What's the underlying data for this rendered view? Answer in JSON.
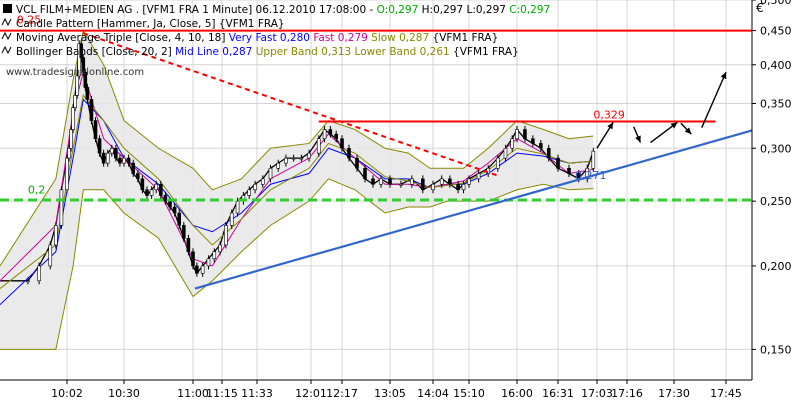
{
  "chart_data": {
    "type": "line",
    "subtype": "candlestick",
    "currency": "€",
    "watermark": "www.tradesignalonline.com",
    "legend_placement": "top-left",
    "log_scale": true,
    "grid": true,
    "ylim": [
      0.135,
      0.5
    ],
    "xlim": [
      "09:50",
      "17:50"
    ],
    "y_ticks": [
      {
        "value": 0.5,
        "label": "0,500"
      },
      {
        "value": 0.45,
        "label": "0,450"
      },
      {
        "value": 0.4,
        "label": "0,400"
      },
      {
        "value": 0.35,
        "label": "0,350"
      },
      {
        "value": 0.3,
        "label": "0,300"
      },
      {
        "value": 0.25,
        "label": "0,250"
      },
      {
        "value": 0.2,
        "label": "0,200"
      },
      {
        "value": 0.15,
        "label": "0,150"
      }
    ],
    "x_ticks": [
      "10:02",
      "10:30",
      "11:00",
      "11:15",
      "11:33",
      "12:01",
      "12:17",
      "13:05",
      "14:04",
      "15:10",
      "16:00",
      "16:31",
      "17:03",
      "17:16",
      "17:30",
      "17:45"
    ],
    "legend": [
      {
        "parts": [
          {
            "text": "VCL FILM+MEDIEN AG . [VFM1 FRA  1 Minute] 06.12.2010 17:08:00 - ",
            "color": "#000000"
          },
          {
            "text": "O:0,297",
            "color": "#00aa00"
          },
          {
            "text": " H:0,297 L:0,297 ",
            "color": "#000000"
          },
          {
            "text": "C:0,297",
            "color": "#00aa00"
          }
        ]
      },
      {
        "parts": [
          {
            "text": "Candle Pattern [Hammer, Ja, Close, 5] {VFM1 FRA}",
            "color": "#000000"
          }
        ]
      },
      {
        "parts": [
          {
            "text": "Moving Average Triple [Close, 4, 10, 18] ",
            "color": "#000000"
          },
          {
            "text": "Very Fast 0,280",
            "color": "#0000ff"
          },
          {
            "text": " ",
            "color": "#000000"
          },
          {
            "text": "Fast 0,279",
            "color": "#cc0099"
          },
          {
            "text": " ",
            "color": "#000000"
          },
          {
            "text": "Slow 0,287",
            "color": "#888800"
          },
          {
            "text": " {VFM1 FRA}",
            "color": "#000000"
          }
        ]
      },
      {
        "parts": [
          {
            "text": "Bollinger Bands [Close, 20, 2] ",
            "color": "#000000"
          },
          {
            "text": "Mid Line 0,287",
            "color": "#0000ff"
          },
          {
            "text": " ",
            "color": "#000000"
          },
          {
            "text": "Upper Band 0,313",
            "color": "#888800"
          },
          {
            "text": " ",
            "color": "#000000"
          },
          {
            "text": "Lower Band 0,261",
            "color": "#888800"
          },
          {
            "text": " {VFM1 FRA}",
            "color": "#000000"
          }
        ]
      }
    ],
    "annotations": [
      {
        "text": "0,329",
        "color": "#ff0000",
        "x": "17:00",
        "y": 0.329
      },
      {
        "text": "0,271",
        "color": "#3366cc",
        "x": "16:45",
        "y": 0.267
      },
      {
        "text": "0,25",
        "color": "#ff0000",
        "x": "09:53",
        "y": 0.456
      },
      {
        "text": "0,2",
        "color": "#00aa00",
        "x": "09:55",
        "y": 0.254
      }
    ],
    "horizontal_lines": [
      {
        "name": "resistance-high",
        "y": 0.45,
        "color": "#ff0000",
        "style": "solid",
        "x_start": "09:50",
        "x_end": "17:50"
      },
      {
        "name": "resistance-mid",
        "y": 0.329,
        "color": "#ff0000",
        "style": "solid",
        "x_start": "12:05",
        "x_end": "17:42"
      },
      {
        "name": "support",
        "y": 0.251,
        "color": "#33cc33",
        "style": "dashed",
        "x_start": "09:50",
        "x_end": "17:50"
      }
    ],
    "trend_lines": [
      {
        "name": "downtrend",
        "color": "#ff0000",
        "style": "dotted",
        "points": [
          [
            "10:10",
            0.446
          ],
          [
            "15:40",
            0.273
          ]
        ]
      },
      {
        "name": "uptrend",
        "color": "#3366cc",
        "style": "solid",
        "points": [
          [
            "11:01",
            0.185
          ],
          [
            "17:50",
            0.319
          ]
        ]
      }
    ],
    "arrows": [
      {
        "from": [
          "17:03",
          0.3
        ],
        "to": [
          "17:10",
          0.328
        ]
      },
      {
        "from": [
          "17:18",
          0.323
        ],
        "to": [
          "17:20",
          0.306
        ]
      },
      {
        "from": [
          "17:23",
          0.306
        ],
        "to": [
          "17:31",
          0.328
        ]
      },
      {
        "from": [
          "17:32",
          0.327
        ],
        "to": [
          "17:35",
          0.315
        ]
      },
      {
        "from": [
          "17:38",
          0.322
        ],
        "to": [
          "17:45",
          0.39
        ]
      }
    ],
    "series": [
      {
        "name": "price",
        "color": "#000000",
        "x": [
          "09:50",
          "09:55",
          "09:57",
          "09:59",
          "10:00",
          "10:01",
          "10:02",
          "10:03",
          "10:04",
          "10:05",
          "10:06",
          "10:07",
          "10:08",
          "10:09",
          "10:10",
          "10:11",
          "10:12",
          "10:14",
          "10:16",
          "10:18",
          "10:20",
          "10:22",
          "10:24",
          "10:26",
          "10:28",
          "10:30",
          "10:32",
          "10:34",
          "10:36",
          "10:38",
          "10:40",
          "10:42",
          "10:44",
          "10:46",
          "10:48",
          "10:50",
          "10:52",
          "10:54",
          "10:56",
          "10:58",
          "11:00",
          "11:02",
          "11:05",
          "11:08",
          "11:11",
          "11:14",
          "11:17",
          "11:20",
          "11:23",
          "11:26",
          "11:29",
          "11:32",
          "11:36",
          "11:40",
          "11:44",
          "11:48",
          "11:52",
          "11:56",
          "12:00",
          "12:05",
          "12:08",
          "12:11",
          "12:14",
          "12:17",
          "12:24",
          "12:32",
          "12:40",
          "12:48",
          "12:56",
          "13:05",
          "13:20",
          "13:35",
          "13:50",
          "14:04",
          "14:20",
          "14:35",
          "14:50",
          "15:00",
          "15:10",
          "15:20",
          "15:30",
          "15:40",
          "15:48",
          "15:55",
          "16:00",
          "16:06",
          "16:12",
          "16:18",
          "16:24",
          "16:31",
          "16:40",
          "16:48",
          "16:55",
          "17:00"
        ],
        "values": [
          0.19,
          0.19,
          0.2,
          0.215,
          0.23,
          0.26,
          0.29,
          0.3,
          0.32,
          0.345,
          0.36,
          0.385,
          0.43,
          0.41,
          0.39,
          0.37,
          0.355,
          0.33,
          0.31,
          0.295,
          0.285,
          0.295,
          0.3,
          0.29,
          0.285,
          0.29,
          0.285,
          0.275,
          0.27,
          0.26,
          0.255,
          0.26,
          0.265,
          0.255,
          0.25,
          0.245,
          0.24,
          0.23,
          0.22,
          0.21,
          0.2,
          0.195,
          0.2,
          0.205,
          0.21,
          0.215,
          0.23,
          0.24,
          0.25,
          0.255,
          0.26,
          0.265,
          0.27,
          0.28,
          0.285,
          0.29,
          0.29,
          0.29,
          0.295,
          0.31,
          0.32,
          0.315,
          0.31,
          0.3,
          0.29,
          0.28,
          0.27,
          0.265,
          0.27,
          0.265,
          0.265,
          0.27,
          0.26,
          0.265,
          0.27,
          0.265,
          0.26,
          0.265,
          0.27,
          0.275,
          0.28,
          0.29,
          0.3,
          0.31,
          0.32,
          0.31,
          0.305,
          0.3,
          0.29,
          0.28,
          0.275,
          0.27,
          0.28,
          0.297
        ]
      },
      {
        "name": "Upper Band",
        "color": "#888800",
        "x": [
          "09:50",
          "10:00",
          "10:05",
          "10:10",
          "10:20",
          "10:30",
          "10:45",
          "11:00",
          "11:10",
          "11:25",
          "11:40",
          "12:00",
          "12:10",
          "12:30",
          "13:00",
          "13:30",
          "14:00",
          "14:30",
          "15:00",
          "15:30",
          "16:00",
          "16:20",
          "16:40",
          "17:00"
        ],
        "values": [
          0.2,
          0.27,
          0.38,
          0.45,
          0.4,
          0.33,
          0.3,
          0.28,
          0.26,
          0.27,
          0.3,
          0.305,
          0.33,
          0.32,
          0.3,
          0.295,
          0.28,
          0.28,
          0.28,
          0.3,
          0.33,
          0.32,
          0.31,
          0.313
        ]
      },
      {
        "name": "Lower Band",
        "color": "#888800",
        "x": [
          "09:50",
          "10:00",
          "10:05",
          "10:10",
          "10:20",
          "10:30",
          "10:45",
          "11:00",
          "11:10",
          "11:25",
          "11:40",
          "12:00",
          "12:10",
          "12:30",
          "13:00",
          "13:30",
          "14:00",
          "14:30",
          "15:00",
          "15:30",
          "16:00",
          "16:20",
          "16:40",
          "17:00"
        ],
        "values": [
          0.15,
          0.15,
          0.2,
          0.26,
          0.26,
          0.24,
          0.22,
          0.18,
          0.19,
          0.21,
          0.23,
          0.25,
          0.27,
          0.26,
          0.24,
          0.245,
          0.245,
          0.25,
          0.25,
          0.25,
          0.26,
          0.265,
          0.26,
          0.261
        ]
      },
      {
        "name": "Mid Line",
        "color": "#0000ff",
        "x": [
          "09:50",
          "10:00",
          "10:05",
          "10:10",
          "10:20",
          "10:30",
          "10:45",
          "11:00",
          "11:10",
          "11:25",
          "11:40",
          "12:00",
          "12:10",
          "12:30",
          "13:00",
          "13:30",
          "14:00",
          "14:30",
          "15:00",
          "15:30",
          "16:00",
          "16:20",
          "16:40",
          "17:00"
        ],
        "values": [
          0.175,
          0.21,
          0.29,
          0.355,
          0.33,
          0.29,
          0.265,
          0.23,
          0.225,
          0.24,
          0.265,
          0.275,
          0.3,
          0.29,
          0.27,
          0.27,
          0.262,
          0.265,
          0.265,
          0.275,
          0.295,
          0.292,
          0.285,
          0.287
        ]
      },
      {
        "name": "Fast",
        "color": "#cc0099",
        "x": [
          "09:50",
          "10:00",
          "10:05",
          "10:10",
          "10:20",
          "10:30",
          "10:45",
          "11:00",
          "11:10",
          "11:25",
          "11:40",
          "12:00",
          "12:10",
          "12:30",
          "13:00",
          "13:30",
          "14:00",
          "14:30",
          "15:00",
          "15:30",
          "16:00",
          "16:20",
          "16:40",
          "17:00"
        ],
        "values": [
          0.19,
          0.23,
          0.34,
          0.39,
          0.31,
          0.29,
          0.26,
          0.205,
          0.2,
          0.235,
          0.27,
          0.29,
          0.315,
          0.29,
          0.265,
          0.265,
          0.262,
          0.265,
          0.268,
          0.285,
          0.31,
          0.295,
          0.275,
          0.279
        ]
      },
      {
        "name": "Slow",
        "color": "#888800",
        "x": [
          "09:50",
          "10:00",
          "10:05",
          "10:10",
          "10:20",
          "10:30",
          "10:45",
          "11:00",
          "11:10",
          "11:25",
          "11:40",
          "12:00",
          "12:10",
          "12:30",
          "13:00",
          "13:30",
          "14:00",
          "14:30",
          "15:00",
          "15:30",
          "16:00",
          "16:20",
          "16:40",
          "17:00"
        ],
        "values": [
          0.185,
          0.215,
          0.3,
          0.36,
          0.33,
          0.3,
          0.27,
          0.23,
          0.215,
          0.235,
          0.26,
          0.28,
          0.305,
          0.295,
          0.272,
          0.268,
          0.262,
          0.264,
          0.266,
          0.278,
          0.3,
          0.294,
          0.285,
          0.287
        ]
      }
    ]
  }
}
